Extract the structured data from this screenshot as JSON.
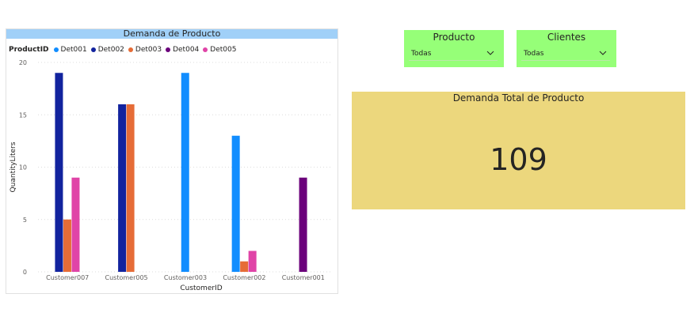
{
  "colors": {
    "Det001": "#118DFF",
    "Det002": "#12239E",
    "Det003": "#E66C37",
    "Det004": "#6B007B",
    "Det005": "#E044A7",
    "header_bar": "#a0d0f8",
    "slicer_bg": "#96ff78",
    "card_bg": "#ecd77d"
  },
  "chart": {
    "header": "Demanda de Producto",
    "legend_title": "ProductID"
  },
  "chart_data": {
    "type": "bar",
    "title": "Demanda de Producto",
    "xlabel": "CustomerID",
    "ylabel": "QuantityLiters",
    "ylim": [
      0,
      20
    ],
    "yticks": [
      0,
      5,
      10,
      15,
      20
    ],
    "grid": true,
    "legend_placement": "top-left",
    "categories": [
      "Customer007",
      "Customer005",
      "Customer003",
      "Customer002",
      "Customer001"
    ],
    "series": [
      {
        "name": "Det001",
        "values": [
          null,
          null,
          19,
          13,
          null
        ]
      },
      {
        "name": "Det002",
        "values": [
          19,
          16,
          null,
          null,
          null
        ]
      },
      {
        "name": "Det003",
        "values": [
          5,
          16,
          null,
          1,
          null
        ]
      },
      {
        "name": "Det004",
        "values": [
          null,
          null,
          null,
          null,
          9
        ]
      },
      {
        "name": "Det005",
        "values": [
          9,
          null,
          null,
          2,
          null
        ]
      }
    ]
  },
  "slicers": [
    {
      "title": "Producto",
      "value": "Todas",
      "icon": "chevron-down-icon"
    },
    {
      "title": "Clientes",
      "value": "Todas",
      "icon": "chevron-down-icon"
    }
  ],
  "card": {
    "title": "Demanda Total de Producto",
    "value": "109"
  }
}
